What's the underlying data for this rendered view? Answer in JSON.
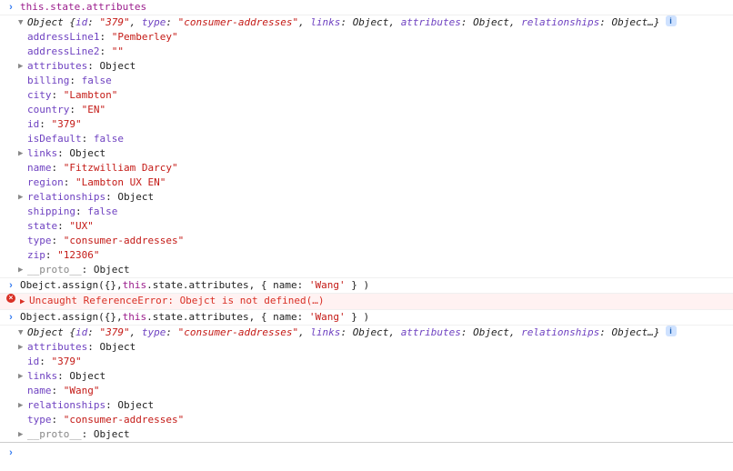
{
  "lines": {
    "cmd1": "this.state.attributes",
    "cmd2_a": "Obejct.assign({},",
    "cmd2_b": "this",
    "cmd2_c": ".state.attributes, { name: ",
    "cmd2_d": "'Wang'",
    "cmd2_e": " } )",
    "err_a": "Uncaught ReferenceError: Obejct is not defined",
    "err_b": "(…)",
    "cmd3_a": "Object.assign({},",
    "cmd3_b": "this",
    "cmd3_c": ".state.attributes, { name: ",
    "cmd3_d": "'Wang'",
    "cmd3_e": " } )"
  },
  "summary": {
    "lead": "Object {",
    "id_k": "id",
    "id_v": "\"379\"",
    "type_k": "type",
    "type_v": "\"consumer-addresses\"",
    "links_k": "links",
    "links_v": "Object",
    "attrs_k": "attributes",
    "attrs_v": "Object",
    "rels_k": "relationships",
    "rels_v": "Object…",
    "close": "}",
    "info": "i"
  },
  "props1": {
    "addressLine1_k": "addressLine1",
    "addressLine1_v": "\"Pemberley\"",
    "addressLine2_k": "addressLine2",
    "addressLine2_v": "\"\"",
    "attributes_k": "attributes",
    "attributes_v": "Object",
    "billing_k": "billing",
    "billing_v": "false",
    "city_k": "city",
    "city_v": "\"Lambton\"",
    "country_k": "country",
    "country_v": "\"EN\"",
    "id_k": "id",
    "id_v": "\"379\"",
    "isDefault_k": "isDefault",
    "isDefault_v": "false",
    "links_k": "links",
    "links_v": "Object",
    "name_k": "name",
    "name_v": "\"Fitzwilliam Darcy\"",
    "region_k": "region",
    "region_v": "\"Lambton UX EN\"",
    "relationships_k": "relationships",
    "relationships_v": "Object",
    "shipping_k": "shipping",
    "shipping_v": "false",
    "state_k": "state",
    "state_v": "\"UX\"",
    "type_k": "type",
    "type_v": "\"consumer-addresses\"",
    "zip_k": "zip",
    "zip_v": "\"12306\"",
    "proto_k": "__proto__",
    "proto_v": "Object"
  },
  "props2": {
    "attributes_k": "attributes",
    "attributes_v": "Object",
    "id_k": "id",
    "id_v": "\"379\"",
    "links_k": "links",
    "links_v": "Object",
    "name_k": "name",
    "name_v": "\"Wang\"",
    "relationships_k": "relationships",
    "relationships_v": "Object",
    "type_k": "type",
    "type_v": "\"consumer-addresses\"",
    "proto_k": "__proto__",
    "proto_v": "Object"
  },
  "sep": ": ",
  "comma": ", "
}
